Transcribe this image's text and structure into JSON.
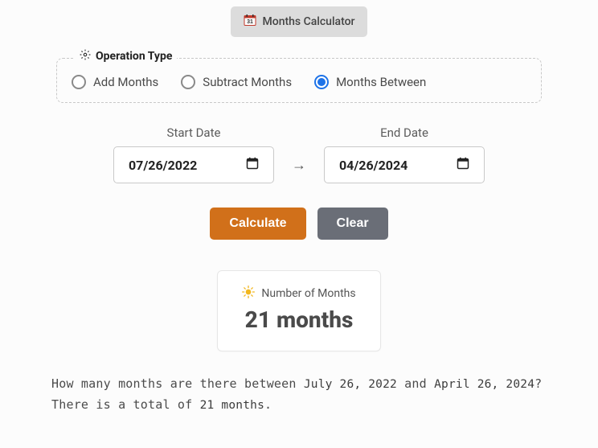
{
  "title": "Months Calculator",
  "operation": {
    "legend": "Operation Type",
    "options": {
      "add": "Add Months",
      "subtract": "Subtract Months",
      "between": "Months Between"
    },
    "selected": "between"
  },
  "dates": {
    "start_label": "Start Date",
    "start_value": "07/26/2022",
    "end_label": "End Date",
    "end_value": "04/26/2024",
    "arrow": "→"
  },
  "buttons": {
    "calculate": "Calculate",
    "clear": "Clear"
  },
  "result": {
    "label": "Number of Months",
    "value": "21 months"
  },
  "description": {
    "a": "How many months are there between ",
    "d1": "July 26, 2022",
    "b": " and ",
    "d2": "April 26, 2024",
    "c": "? There is a total of ",
    "n": "21 months",
    "d": "."
  }
}
